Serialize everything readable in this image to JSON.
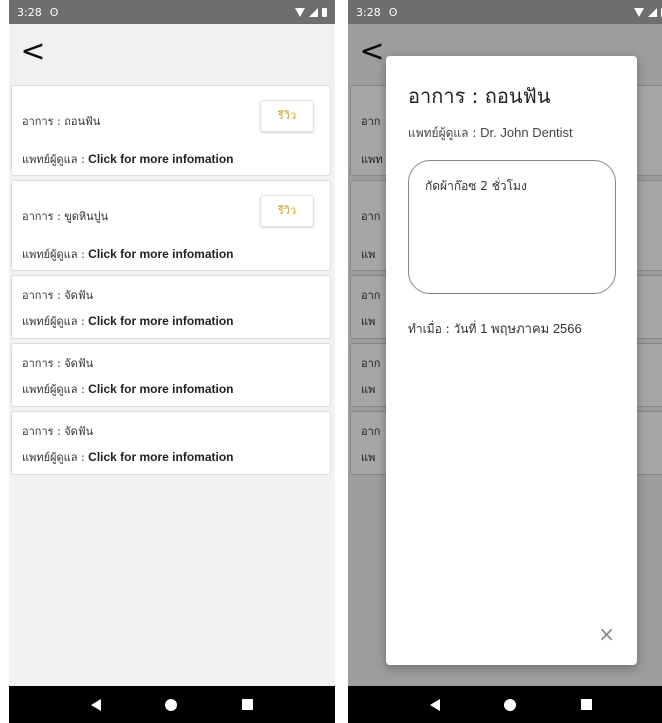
{
  "left": {
    "status": {
      "time": "3:28",
      "sim_glyph": "ʘ"
    },
    "app_bar": {
      "back_glyph": "<"
    },
    "records": [
      {
        "symptom": "อาการ : ถอนฟัน",
        "doctor_label": "แพทย์ผู้ดูแล : ",
        "doctor_value": "Click for more infomation",
        "review": "รีวิว"
      },
      {
        "symptom": "อาการ : ขูดหินปูน",
        "doctor_label": "แพทย์ผู้ดูแล : ",
        "doctor_value": "Click for more infomation",
        "review": "รีวิว"
      },
      {
        "symptom": "อาการ : จัดฟัน",
        "doctor_label": "แพทย์ผู้ดูแล : ",
        "doctor_value": "Click for more infomation"
      },
      {
        "symptom": "อาการ : จัดฟัน",
        "doctor_label": "แพทย์ผู้ดูแล : ",
        "doctor_value": "Click for more infomation"
      },
      {
        "symptom": "อาการ : จัดฟัน",
        "doctor_label": "แพทย์ผู้ดูแล : ",
        "doctor_value": "Click for more infomation"
      }
    ]
  },
  "right": {
    "status": {
      "time": "3:28",
      "sim_glyph": "ʘ"
    },
    "app_bar": {
      "back_glyph": "<"
    },
    "dialog": {
      "title": "อาการ : ถอนฟัน",
      "doctor_label": "แพทย์ผู้ดูแล : ",
      "doctor_value": "Dr. John Dentist",
      "note": "กัดผ้าก๊อซ 2 ชั่วโมง",
      "date_label": "ทำเมื่อ : วันที่ ",
      "date_value": "1 พฤษภาคม 2566",
      "close_glyph": "×"
    },
    "ghost_rows": [
      {
        "symptom": "อาก",
        "doctor": "แพท"
      },
      {
        "symptom": "อาก",
        "doctor": "แพ"
      },
      {
        "symptom": "อาก",
        "doctor": "แพ"
      },
      {
        "symptom": "อาก",
        "doctor": "แพ"
      },
      {
        "symptom": "อาก",
        "doctor": "แพ"
      }
    ]
  },
  "colors": {
    "review_text": "#c9a227",
    "nav_bar": "#000000",
    "status_bar": "#6e6e6e"
  }
}
